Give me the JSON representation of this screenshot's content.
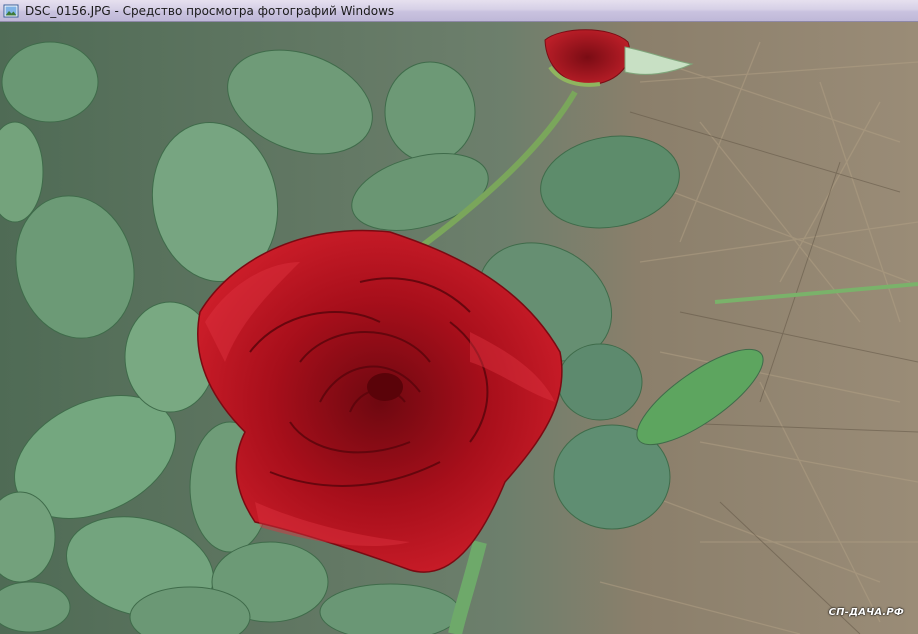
{
  "window": {
    "title": "DSC_0156.JPG - Средство просмотра фотографий Windows",
    "icon": "photo-viewer-app-icon"
  },
  "photo": {
    "subject": "red rose",
    "watermark": "СП-ДАЧА.РФ"
  },
  "colors": {
    "titlebar": "#d6d0e6",
    "rose": "#b3101c",
    "leaf": "#5f8f6a",
    "mulch": "#8a7c66"
  }
}
